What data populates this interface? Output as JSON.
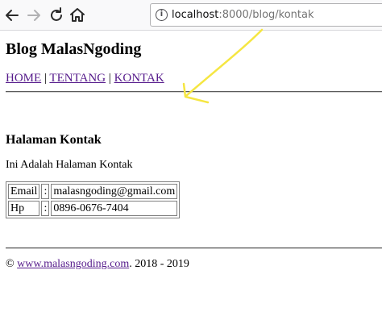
{
  "browser": {
    "url_host": "localhost",
    "url_path": ":8000/blog/kontak",
    "info_icon": "info-icon",
    "back_icon": "back-arrow-icon",
    "forward_icon": "forward-arrow-icon",
    "reload_icon": "reload-icon",
    "home_icon": "home-icon"
  },
  "site": {
    "title": "Blog MalasNgoding",
    "nav": [
      {
        "label": "HOME"
      },
      {
        "label": "TENTANG"
      },
      {
        "label": "KONTAK"
      }
    ],
    "nav_separator": "|"
  },
  "content": {
    "heading": "Halaman Kontak",
    "intro": "Ini Adalah Halaman Kontak",
    "table": [
      {
        "label": "Email",
        "sep": ":",
        "value": "malasngoding@gmail.com"
      },
      {
        "label": "Hp",
        "sep": ":",
        "value": "0896-0676-7404"
      }
    ]
  },
  "footer": {
    "copyright": "©",
    "link_text": "www.malasngoding.com",
    "suffix": ". 2018 - 2019"
  },
  "colors": {
    "link_visited": "#551a8b",
    "annotation": "#f5e642",
    "toolbar_bg": "#f9f9fa"
  }
}
